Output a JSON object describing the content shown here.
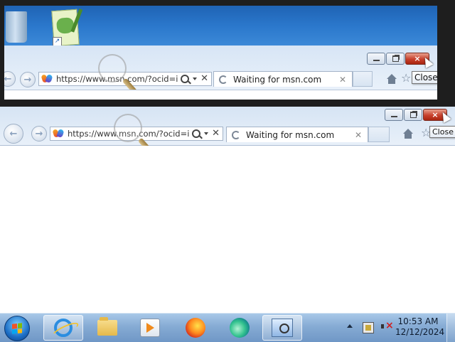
{
  "zoom": {
    "address": {
      "url": "https://www.msn.com/?ocid=i"
    },
    "tab": {
      "title": "Waiting for msn.com"
    },
    "tooltip": "Close"
  },
  "window": {
    "address": {
      "url": "https://www.msn.com/?ocid=i"
    },
    "tab": {
      "title": "Waiting for msn.com"
    },
    "tooltip": "Close",
    "buttons": {
      "minimize": "minimize",
      "restore": "restore",
      "close": "close"
    }
  },
  "icons": {
    "desktop": [
      "recycle-bin-icon",
      "notepad-plus-plus-icon"
    ],
    "taskbar": [
      "internet-explorer-icon",
      "file-explorer-icon",
      "media-player-icon",
      "firefox-icon",
      "edge-icon",
      "remote-desktop-icon"
    ]
  },
  "taskbar": {
    "clock": {
      "time": "10:53 AM",
      "date": "12/12/2024"
    }
  },
  "colors": {
    "taskbar": "#86abd4",
    "chrome": "#d6e4f4",
    "close_button": "#c8402c"
  }
}
